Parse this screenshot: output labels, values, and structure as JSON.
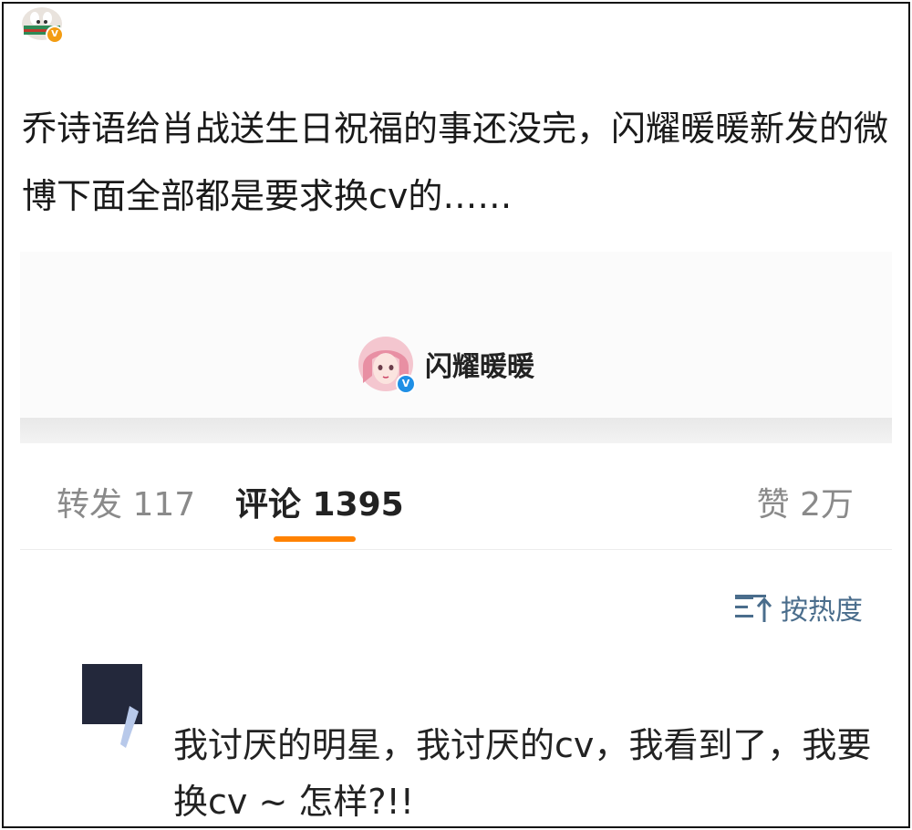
{
  "post": {
    "text": "乔诗语给肖战送生日祝福的事还没完，闪耀暖暖新发的微博下面全部都是要求换cv的……"
  },
  "embed": {
    "author": "闪耀暖暖",
    "tabs": {
      "repost": "转发 117",
      "comment": "评论 1395",
      "like": "赞 2万"
    },
    "sort_label": "按热度",
    "comment_text": "我讨厌的明星，我讨厌的cv，我看到了，我要换cv ~ 怎样?!!"
  },
  "colors": {
    "accent": "#ff8200",
    "verified": "#1f8fe5",
    "sort": "#4a6d8c"
  },
  "icons": [
    "user-avatar-icon",
    "verified-badge-icon",
    "sort-hot-icon"
  ]
}
